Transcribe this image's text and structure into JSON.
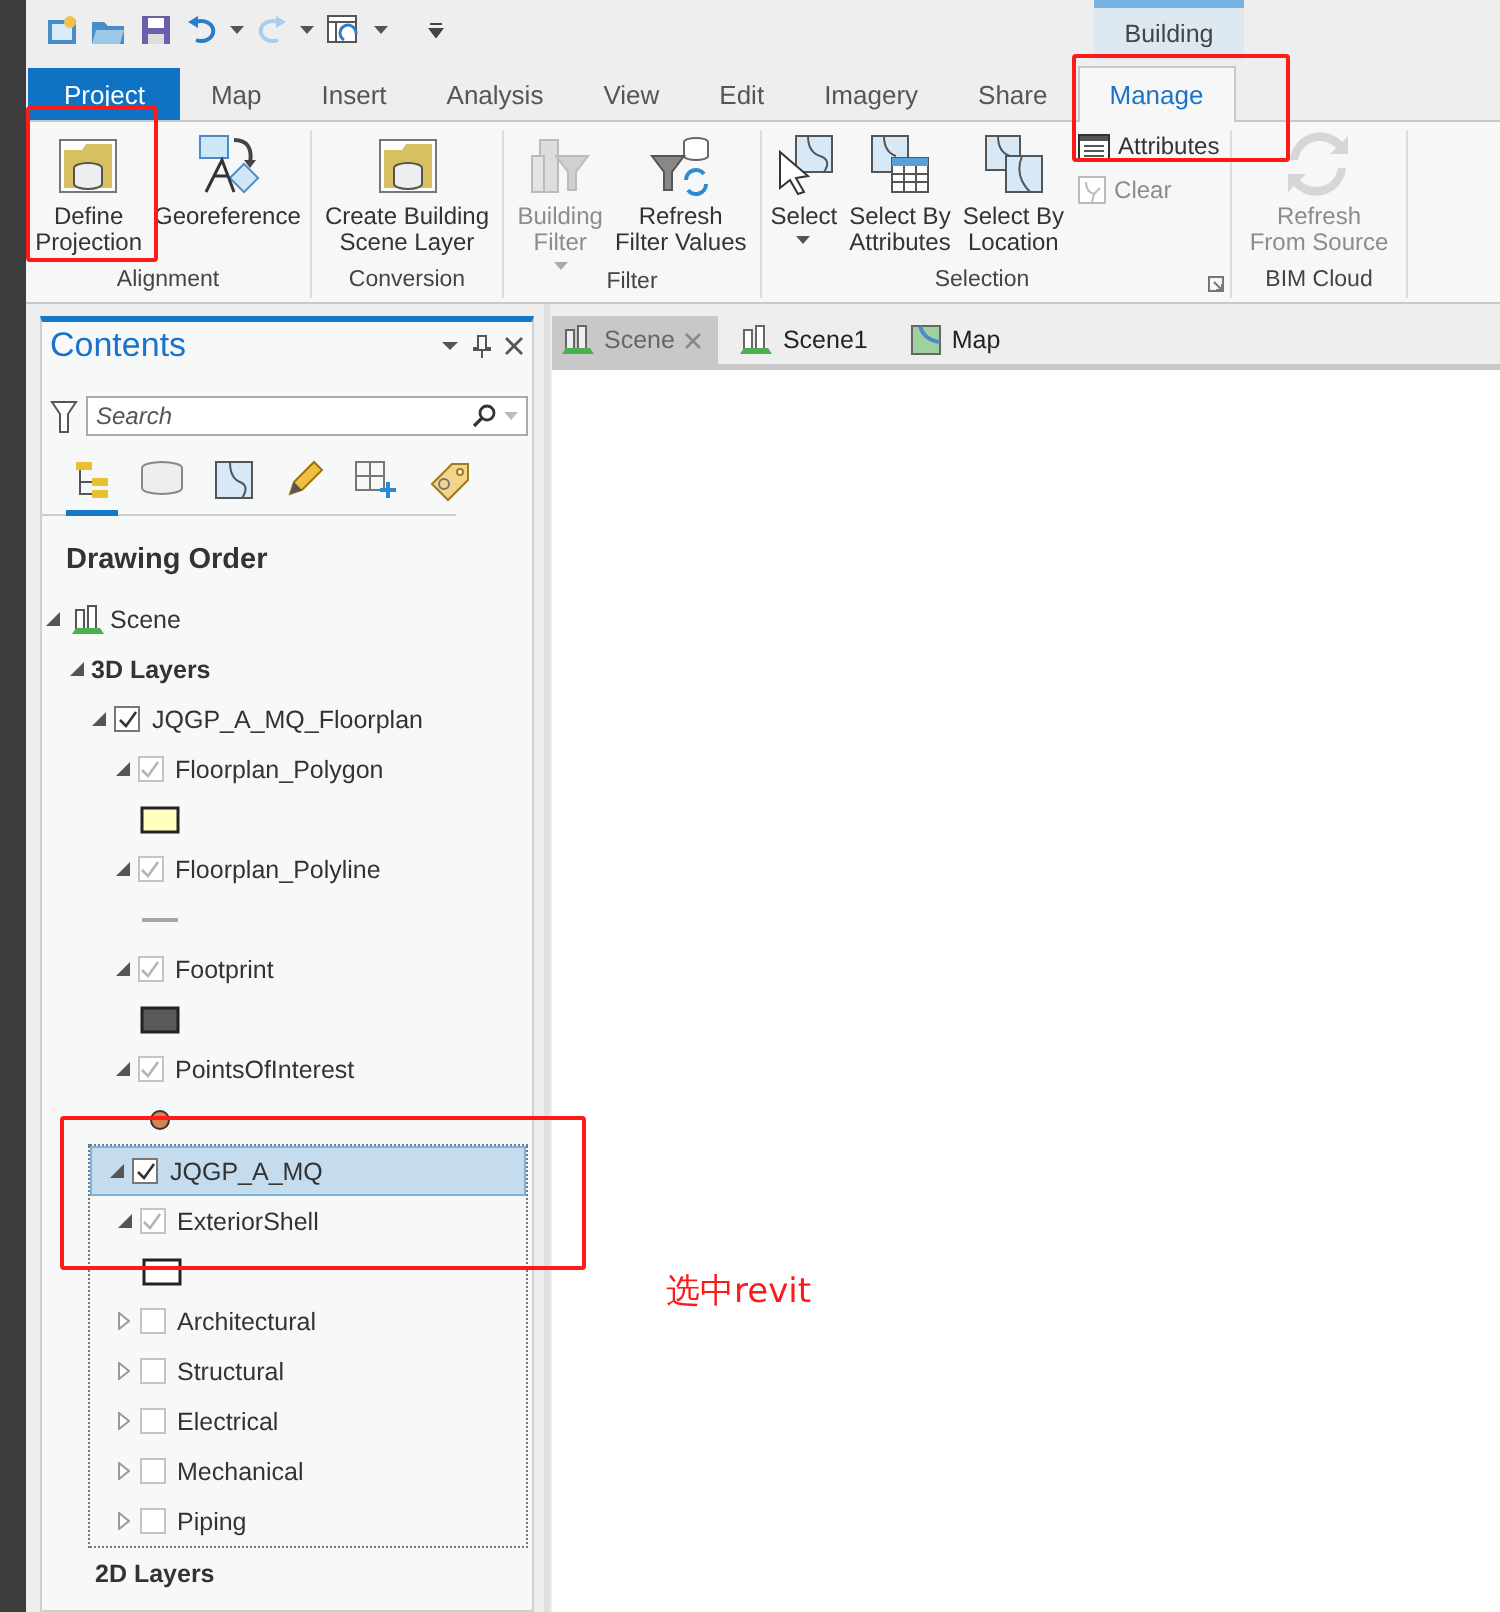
{
  "contextual_tab": {
    "label": "Building"
  },
  "tabs": [
    {
      "label": "Project",
      "kind": "backstage",
      "selected": false
    },
    {
      "label": "Map",
      "kind": "tab",
      "selected": false
    },
    {
      "label": "Insert",
      "kind": "tab",
      "selected": false
    },
    {
      "label": "Analysis",
      "kind": "tab",
      "selected": false
    },
    {
      "label": "View",
      "kind": "tab",
      "selected": false
    },
    {
      "label": "Edit",
      "kind": "tab",
      "selected": false
    },
    {
      "label": "Imagery",
      "kind": "tab",
      "selected": false
    },
    {
      "label": "Share",
      "kind": "tab",
      "selected": false
    },
    {
      "label": "Manage",
      "kind": "tab",
      "selected": true
    }
  ],
  "ribbon_groups": [
    {
      "label": "Alignment",
      "buttons": [
        {
          "label": "Define\nProjection",
          "kind": "large",
          "disabled": false
        },
        {
          "label": "Georeference",
          "kind": "large",
          "disabled": false
        }
      ]
    },
    {
      "label": "Conversion",
      "buttons": [
        {
          "label": "Create Building\nScene Layer",
          "kind": "large",
          "disabled": false
        }
      ]
    },
    {
      "label": "Filter",
      "buttons": [
        {
          "label": "Building\nFilter",
          "kind": "large",
          "disabled": true,
          "dropdown": true
        },
        {
          "label": "Refresh\nFilter Values",
          "kind": "large",
          "disabled": false
        }
      ]
    },
    {
      "label": "Selection",
      "launcher": true,
      "buttons": [
        {
          "label": "Select",
          "kind": "large",
          "disabled": false,
          "dropdown": true
        },
        {
          "label": "Select By\nAttributes",
          "kind": "large",
          "disabled": false
        },
        {
          "label": "Select By\nLocation",
          "kind": "large",
          "disabled": false
        },
        {
          "label": "Attributes",
          "kind": "small",
          "disabled": false
        },
        {
          "label": "Clear",
          "kind": "small",
          "disabled": true
        }
      ]
    },
    {
      "label": "BIM Cloud",
      "buttons": [
        {
          "label": "Refresh\nFrom Source",
          "kind": "large",
          "disabled": true
        }
      ]
    }
  ],
  "contents": {
    "title": "Contents",
    "search": {
      "placeholder": "Search"
    },
    "view_tabs": [
      {
        "kind": "drawing-order",
        "selected": true
      },
      {
        "kind": "source",
        "selected": false
      },
      {
        "kind": "selection",
        "selected": false
      },
      {
        "kind": "editing",
        "selected": false
      },
      {
        "kind": "snapping",
        "selected": false
      },
      {
        "kind": "labeling",
        "selected": false
      }
    ],
    "heading": "Drawing Order",
    "tree": [
      {
        "label": "Scene",
        "kind": "scene",
        "expanded": true,
        "children": [
          {
            "label": "3D Layers",
            "kind": "group",
            "expanded": true,
            "children": [
              {
                "label": "JQGP_A_MQ_Floorplan",
                "kind": "layer",
                "expanded": true,
                "checked": true,
                "disabled": false,
                "selected": false,
                "children": [
                  {
                    "label": "Floorplan_Polygon",
                    "kind": "layer",
                    "expanded": true,
                    "checked": true,
                    "disabled": true,
                    "selected": false,
                    "symbol": {
                      "kind": "fill",
                      "color": "#ffffc0"
                    }
                  },
                  {
                    "label": "Floorplan_Polyline",
                    "kind": "layer",
                    "expanded": true,
                    "checked": true,
                    "disabled": true,
                    "selected": false,
                    "symbol": {
                      "kind": "line",
                      "color": "#a6a6a6"
                    }
                  },
                  {
                    "label": "Footprint",
                    "kind": "layer",
                    "expanded": true,
                    "checked": true,
                    "disabled": true,
                    "selected": false,
                    "symbol": {
                      "kind": "fill",
                      "color": "#595959"
                    }
                  },
                  {
                    "label": "PointsOfInterest",
                    "kind": "layer",
                    "expanded": true,
                    "checked": true,
                    "disabled": true,
                    "selected": false,
                    "symbol": {
                      "kind": "point",
                      "color": "#d9804f"
                    }
                  }
                ]
              },
              {
                "label": "JQGP_A_MQ",
                "kind": "layer",
                "expanded": true,
                "checked": true,
                "disabled": false,
                "selected": true,
                "children": [
                  {
                    "label": "ExteriorShell",
                    "kind": "layer",
                    "expanded": true,
                    "checked": true,
                    "disabled": true,
                    "selected": false,
                    "symbol": {
                      "kind": "fill",
                      "color": "#ffffff"
                    }
                  },
                  {
                    "label": "Architectural",
                    "kind": "layer",
                    "expanded": false,
                    "checked": false,
                    "disabled": false,
                    "selected": false
                  },
                  {
                    "label": "Structural",
                    "kind": "layer",
                    "expanded": false,
                    "checked": false,
                    "disabled": false,
                    "selected": false
                  },
                  {
                    "label": "Electrical",
                    "kind": "layer",
                    "expanded": false,
                    "checked": false,
                    "disabled": false,
                    "selected": false
                  },
                  {
                    "label": "Mechanical",
                    "kind": "layer",
                    "expanded": false,
                    "checked": false,
                    "disabled": false,
                    "selected": false
                  },
                  {
                    "label": "Piping",
                    "kind": "layer",
                    "expanded": false,
                    "checked": false,
                    "disabled": false,
                    "selected": false
                  }
                ]
              }
            ]
          },
          {
            "label": "2D Layers",
            "kind": "group"
          }
        ]
      }
    ]
  },
  "view_tabs": [
    {
      "label": "Scene",
      "kind": "scene",
      "selected": true,
      "closable": true
    },
    {
      "label": "Scene1",
      "kind": "scene",
      "selected": false
    },
    {
      "label": "Map",
      "kind": "map",
      "selected": false
    }
  ],
  "annotation": {
    "note": "选中revit"
  }
}
